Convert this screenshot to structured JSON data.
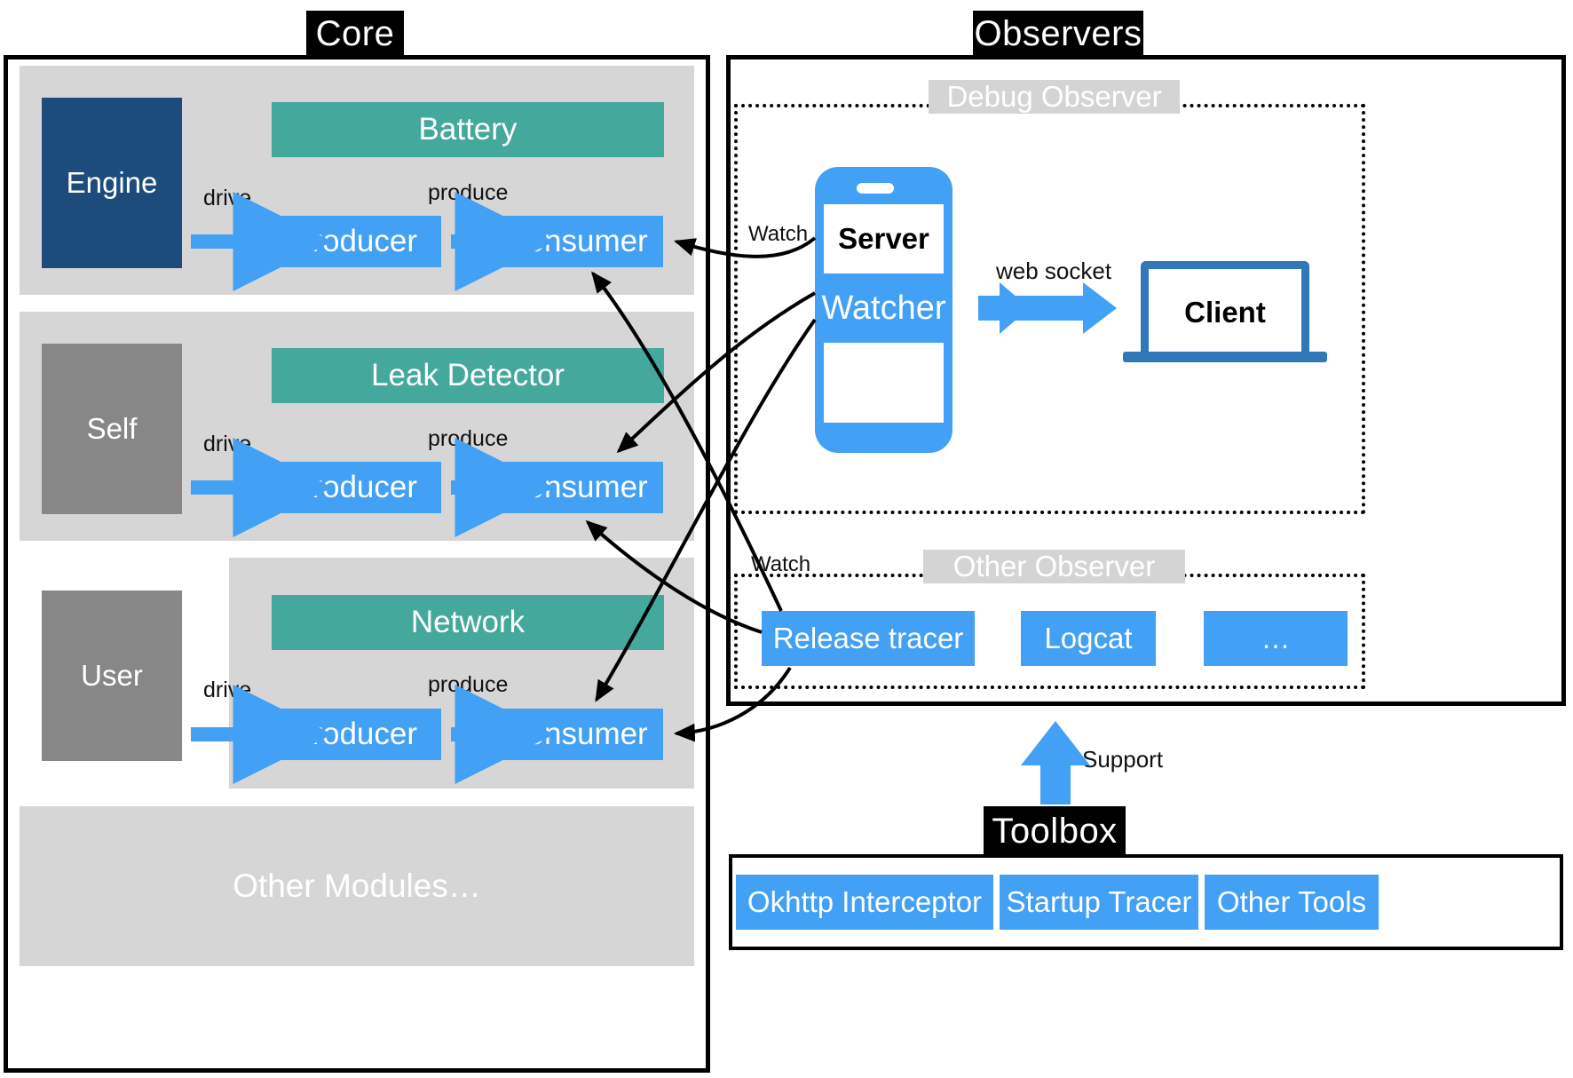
{
  "colors": {
    "accent_blue": "#42a0f5",
    "teal": "#45a89c",
    "dark_blue": "#1d4c7c",
    "gray_actor": "#878787",
    "panel_gray": "#d6d6d6",
    "tag_black": "#000000",
    "laptop_blue": "#3178b8"
  },
  "core": {
    "tag": "Core",
    "rows": [
      {
        "actor": "Engine",
        "module": "Battery",
        "drive_label": "drive",
        "produce_label": "produce",
        "producer": "Producer",
        "consumer": "Consumer"
      },
      {
        "actor": "Self",
        "module": "Leak Detector",
        "drive_label": "drive",
        "produce_label": "produce",
        "producer": "Producer",
        "consumer": "Consumer"
      },
      {
        "actor": "User",
        "module": "Network",
        "drive_label": "drive",
        "produce_label": "produce",
        "producer": "Producer",
        "consumer": "Consumer"
      }
    ],
    "other_modules": "Other Modules…"
  },
  "observers": {
    "tag": "Observers",
    "debug": {
      "tag": "Debug Observer",
      "phone": {
        "server": "Server",
        "watcher": "Watcher"
      },
      "socket_label": "web socket",
      "client": "Client"
    },
    "other": {
      "tag": "Other Observer",
      "items": [
        "Release tracer",
        "Logcat",
        "…"
      ]
    },
    "watch_label_top": "Watch",
    "watch_label_bottom": "Watch"
  },
  "toolbox": {
    "tag": "Toolbox",
    "support_label": "Support",
    "items": [
      "Okhttp Interceptor",
      "Startup Tracer",
      "Other Tools"
    ]
  }
}
